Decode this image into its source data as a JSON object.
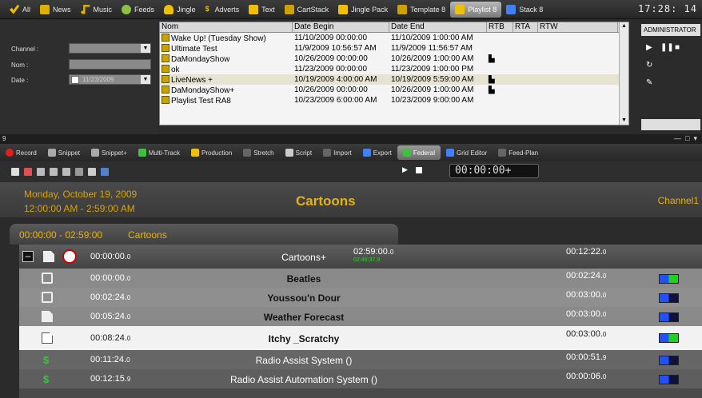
{
  "top_tabs": [
    {
      "label": "All",
      "icon": "check-icon",
      "color": "#f0c000"
    },
    {
      "label": "News",
      "icon": "news-icon",
      "color": "#e0b000"
    },
    {
      "label": "Music",
      "icon": "music-icon",
      "color": "#e0b000"
    },
    {
      "label": "Feeds",
      "icon": "feeds-icon",
      "color": "#8cc040"
    },
    {
      "label": "Jingle",
      "icon": "jingle-icon",
      "color": "#f0c000"
    },
    {
      "label": "Adverts",
      "icon": "dollar-icon",
      "color": "#f0c000"
    },
    {
      "label": "Text",
      "icon": "text-icon",
      "color": "#f0c000"
    },
    {
      "label": "CartStack",
      "icon": "cartstack-icon",
      "color": "#d0a000"
    },
    {
      "label": "Jingle Pack",
      "icon": "jingle-pack-icon",
      "color": "#f0c000"
    },
    {
      "label": "Template 8",
      "icon": "template-icon",
      "color": "#d0a000"
    },
    {
      "label": "Playlist 8",
      "icon": "playlist-icon",
      "color": "#f0c000",
      "active": true
    },
    {
      "label": "Stack 8",
      "icon": "stack-icon",
      "color": "#4080ff"
    }
  ],
  "clock": "17:28: 14",
  "filter": {
    "channel_label": "Channel :",
    "nom_label": "Nom :",
    "date_label": "Date :",
    "date_value": "11/23/2009"
  },
  "playlist_table": {
    "headers": [
      "Nom",
      "Date Begin",
      "Date End",
      "RTB",
      "RTA",
      "RTW"
    ],
    "rows": [
      {
        "nom": "Wake Up! (Tuesday Show)",
        "begin": "11/10/2009 00:00:00",
        "end": "11/10/2009 1:00:00 AM",
        "flag": false
      },
      {
        "nom": "Ultimate Test",
        "begin": "11/9/2009 10:56:57 AM",
        "end": "11/9/2009 11:56:57 AM",
        "flag": false
      },
      {
        "nom": "DaMondayShow",
        "begin": "10/26/2009 00:00:00",
        "end": "10/26/2009 1:00:00 AM",
        "flag": true
      },
      {
        "nom": "ok",
        "begin": "11/23/2009 00:00:00",
        "end": "11/23/2009 1:00:00 PM",
        "flag": false
      },
      {
        "nom": "LiveNews +",
        "begin": "10/19/2009 4:00:00 AM",
        "end": "10/19/2009 5:59:00 AM",
        "flag": true,
        "selected": true
      },
      {
        "nom": "DaMondayShow+",
        "begin": "10/26/2009 00:00:00",
        "end": "10/26/2009 1:00:00 AM",
        "flag": true
      },
      {
        "nom": "Playlist Test RA8",
        "begin": "10/23/2009 6:00:00 AM",
        "end": "10/23/2009 9:00:00 AM",
        "flag": false
      }
    ]
  },
  "admin": {
    "label": "ADMINISTRATOR"
  },
  "mid_number": "9",
  "toolbar2": [
    {
      "label": "Record",
      "icon": "record-icon",
      "color": "#e02020"
    },
    {
      "label": "Snippet",
      "icon": "snippet-icon",
      "color": "#aaaaaa"
    },
    {
      "label": "Snippet+",
      "icon": "snippet-plus-icon",
      "color": "#aaaaaa"
    },
    {
      "label": "Multi-Track",
      "icon": "multitrack-icon",
      "color": "#40c040"
    },
    {
      "label": "Production",
      "icon": "production-icon",
      "color": "#f0c000"
    },
    {
      "label": "Stretch",
      "icon": "stretch-icon",
      "color": "#888888"
    },
    {
      "label": "Script",
      "icon": "script-icon",
      "color": "#cccccc"
    },
    {
      "label": "Import",
      "icon": "import-icon",
      "color": "#888888"
    },
    {
      "label": "Export",
      "icon": "export-icon",
      "color": "#4080ff"
    },
    {
      "label": "Federal",
      "icon": "federal-icon",
      "color": "#40c040",
      "active": true
    },
    {
      "label": "Grid Editor",
      "icon": "grid-editor-icon",
      "color": "#4080ff"
    },
    {
      "label": "Feed-Plan",
      "icon": "feed-plan-icon",
      "color": "#888888"
    }
  ],
  "counter": "00:00:00+",
  "schedule": {
    "date": "Monday, October 19, 2009",
    "time_range": "12:00:00 AM  -  2:59:00 AM",
    "title": "Cartoons",
    "channel": "Channel1",
    "block_range": "00:00:00 - 02:59:00",
    "block_name": "Cartoons"
  },
  "rows": [
    {
      "type": "header",
      "time": "00:00:00.",
      "time_sub": "0",
      "name": "Cartoons+",
      "end": "02:59:00.",
      "end_sub": "0",
      "end_small": "02:46:37.9",
      "dur": "00:12:22.",
      "dur_sub": "0"
    },
    {
      "type": "music",
      "time": "00:00:00.",
      "time_sub": "0",
      "name": "Beatles",
      "dur": "00:02:24.",
      "dur_sub": "0",
      "color": "green"
    },
    {
      "type": "music",
      "time": "00:02:24.",
      "time_sub": "0",
      "name": "Youssou'n Dour",
      "dur": "00:03:00.",
      "dur_sub": "0",
      "color": "blue"
    },
    {
      "type": "doc",
      "time": "00:05:24.",
      "time_sub": "0",
      "name": "Weather Forecast",
      "dur": "00:03:00.",
      "dur_sub": "0",
      "color": "blue"
    },
    {
      "type": "doc",
      "time": "00:08:24.",
      "time_sub": "0",
      "name": "Itchy _Scratchy",
      "dur": "00:03:00.",
      "dur_sub": "0",
      "color": "green",
      "selected": true
    },
    {
      "type": "dollar",
      "time": "00:11:24.",
      "time_sub": "0",
      "name": "Radio Assist System ()",
      "dur": "00:00:51.",
      "dur_sub": "9",
      "color": "blue"
    },
    {
      "type": "dollar",
      "time": "00:12:15.",
      "time_sub": "9",
      "name": "Radio Assist Automation System ()",
      "dur": "00:00:06.",
      "dur_sub": "0",
      "color": "blue"
    }
  ]
}
